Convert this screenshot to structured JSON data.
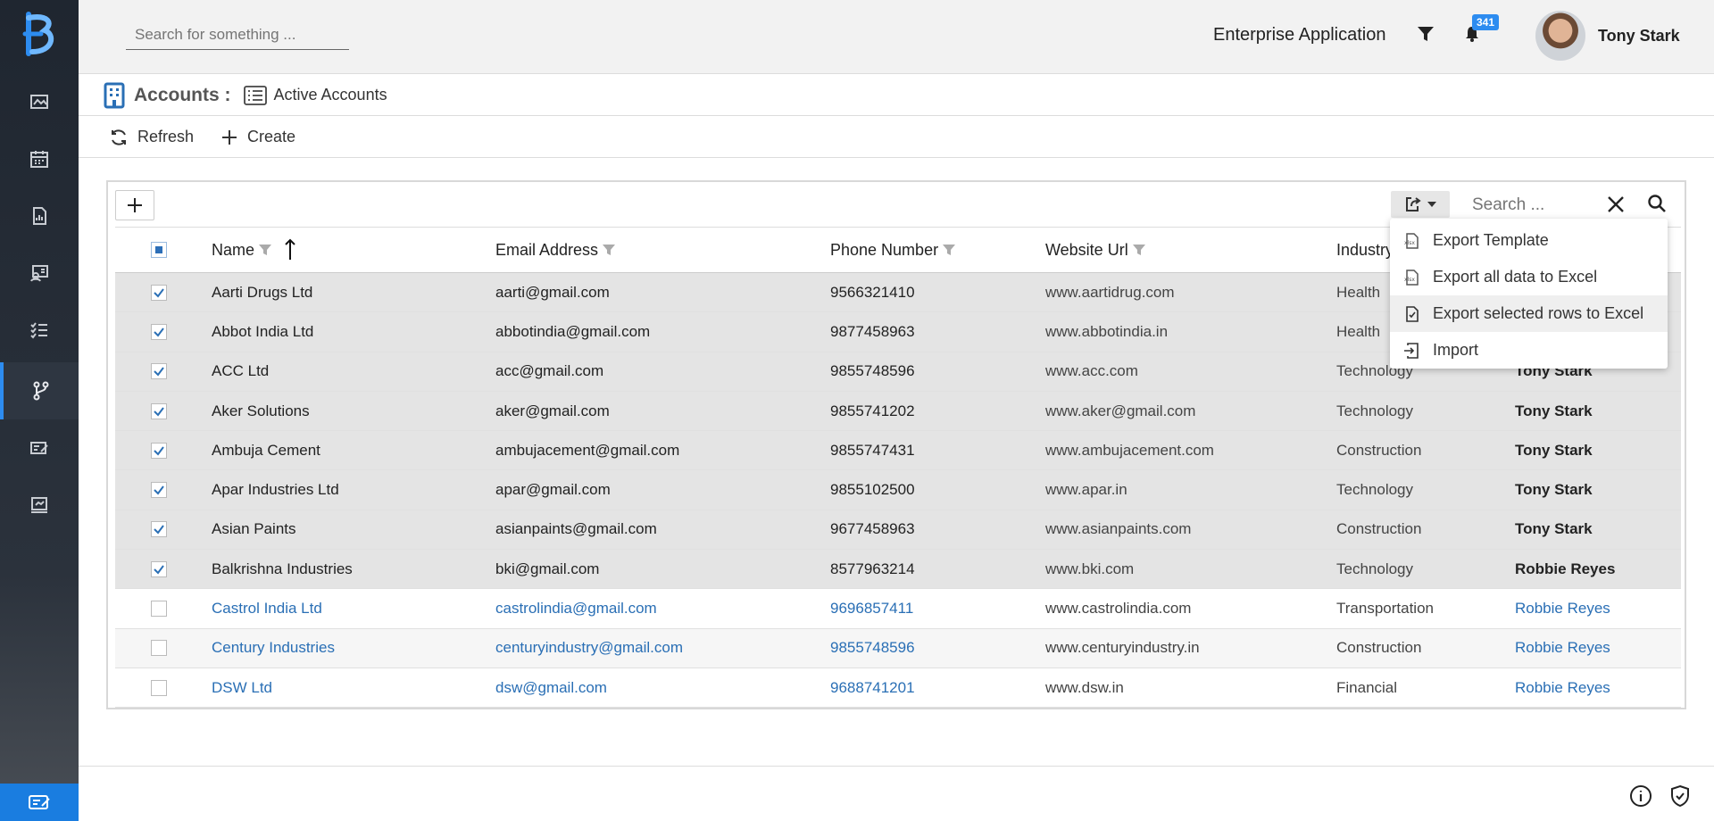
{
  "header": {
    "search_placeholder": "Search for something ...",
    "app_title": "Enterprise Application",
    "notification_count": "341",
    "user_name": "Tony Stark"
  },
  "breadcrumb": {
    "title": "Accounts :",
    "view": "Active Accounts"
  },
  "toolbar": {
    "refresh_label": "Refresh",
    "create_label": "Create"
  },
  "panel": {
    "search_placeholder": "Search ..."
  },
  "table": {
    "columns": {
      "name": "Name",
      "email": "Email Address",
      "phone": "Phone Number",
      "website": "Website Url",
      "industry": "Industry"
    },
    "rows": [
      {
        "name": "Aarti Drugs Ltd",
        "email": "aarti@gmail.com",
        "phone": "9566321410",
        "website": "www.aartidrug.com",
        "industry": "Health",
        "owner": ""
      },
      {
        "name": "Abbot India Ltd",
        "email": "abbotindia@gmail.com",
        "phone": "9877458963",
        "website": "www.abbotindia.in",
        "industry": "Health",
        "owner": ""
      },
      {
        "name": "ACC Ltd",
        "email": "acc@gmail.com",
        "phone": "9855748596",
        "website": "www.acc.com",
        "industry": "Technology",
        "owner": "Tony Stark"
      },
      {
        "name": "Aker Solutions",
        "email": "aker@gmail.com",
        "phone": "9855741202",
        "website": "www.aker@gmail.com",
        "industry": "Technology",
        "owner": "Tony Stark"
      },
      {
        "name": "Ambuja Cement",
        "email": "ambujacement@gmail.com",
        "phone": "9855747431",
        "website": "www.ambujacement.com",
        "industry": "Construction",
        "owner": "Tony Stark"
      },
      {
        "name": "Apar Industries Ltd",
        "email": "apar@gmail.com",
        "phone": "9855102500",
        "website": "www.apar.in",
        "industry": "Technology",
        "owner": "Tony Stark"
      },
      {
        "name": "Asian Paints",
        "email": "asianpaints@gmail.com",
        "phone": "9677458963",
        "website": "www.asianpaints.com",
        "industry": "Construction",
        "owner": "Tony Stark"
      },
      {
        "name": "Balkrishna Industries",
        "email": "bki@gmail.com",
        "phone": "8577963214",
        "website": "www.bki.com",
        "industry": "Technology",
        "owner": "Robbie Reyes"
      },
      {
        "name": "Castrol India Ltd",
        "email": "castrolindia@gmail.com",
        "phone": "9696857411",
        "website": "www.castrolindia.com",
        "industry": "Transportation",
        "owner": "Robbie Reyes"
      },
      {
        "name": "Century Industries",
        "email": "centuryindustry@gmail.com",
        "phone": "9855748596",
        "website": "www.centuryindustry.in",
        "industry": "Construction",
        "owner": "Robbie Reyes"
      },
      {
        "name": "DSW Ltd",
        "email": "dsw@gmail.com",
        "phone": "9688741201",
        "website": "www.dsw.in",
        "industry": "Financial",
        "owner": "Robbie Reyes"
      }
    ]
  },
  "export_menu": {
    "items": [
      "Export Template",
      "Export all data to Excel",
      "Export selected rows to Excel",
      "Import"
    ]
  },
  "colors": {
    "sidebar": "#1f2630",
    "accent": "#2d8cf0",
    "link": "#2a6fb5",
    "selected_row": "#e4e4e4"
  }
}
